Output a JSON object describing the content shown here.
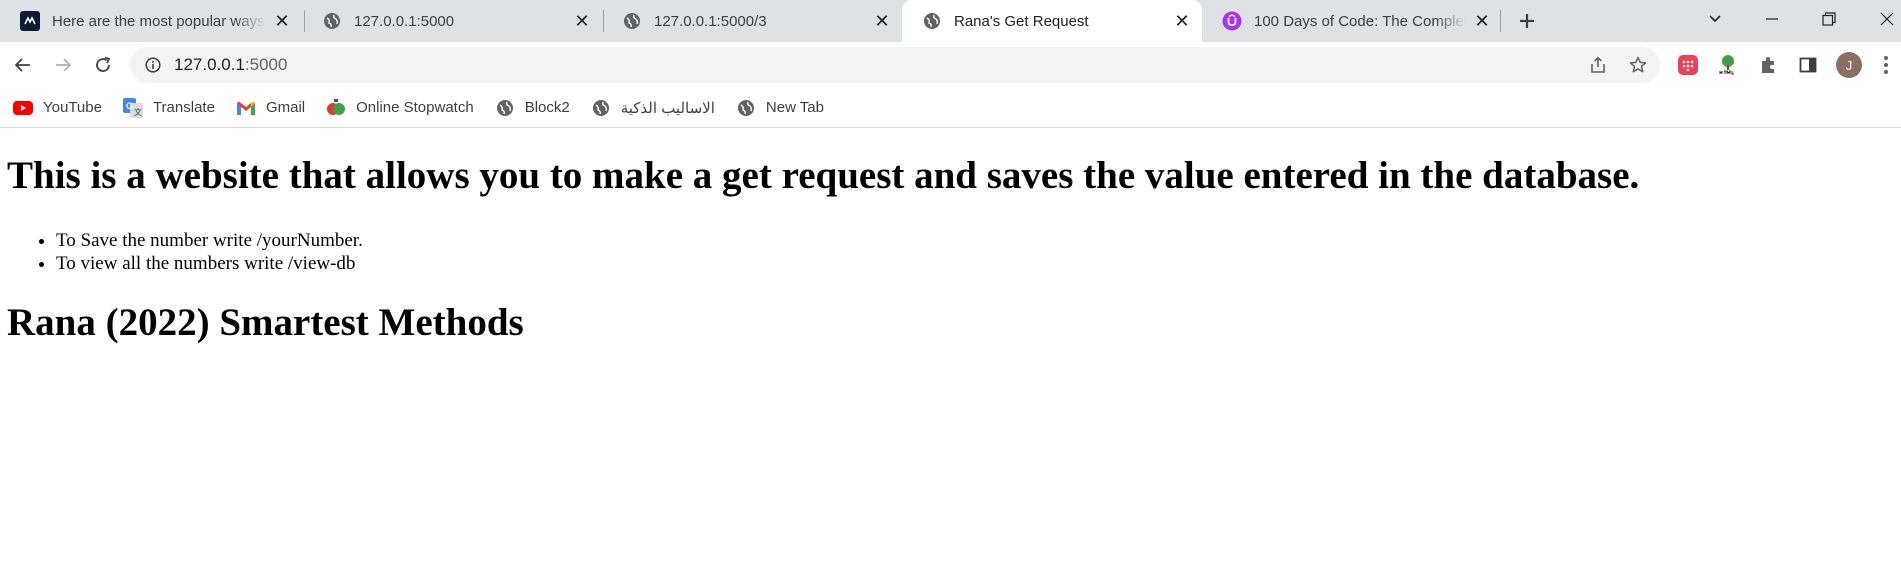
{
  "tabs": [
    {
      "title": "Here are the most popular ways t",
      "icon": "alpine-logo-icon",
      "active": false
    },
    {
      "title": "127.0.0.1:5000",
      "icon": "globe-icon",
      "active": false
    },
    {
      "title": "127.0.0.1:5000/3",
      "icon": "globe-icon",
      "active": false
    },
    {
      "title": "Rana's Get Request",
      "icon": "globe-icon",
      "active": true
    },
    {
      "title": "100 Days of Code: The Complete",
      "icon": "udemy-icon",
      "active": false
    }
  ],
  "address_bar": {
    "host": "127.0.0.1",
    "port": ":5000"
  },
  "bookmarks": [
    {
      "label": "YouTube",
      "icon": "youtube-icon"
    },
    {
      "label": "Translate",
      "icon": "translate-icon"
    },
    {
      "label": "Gmail",
      "icon": "gmail-icon"
    },
    {
      "label": "Online Stopwatch",
      "icon": "stopwatch-icon"
    },
    {
      "label": "Block2",
      "icon": "globe-icon"
    },
    {
      "label": "الاساليب الذكية",
      "icon": "globe-icon"
    },
    {
      "label": "New Tab",
      "icon": "globe-icon"
    }
  ],
  "profile": {
    "initial": "J",
    "color": "#8d6e63"
  },
  "page": {
    "heading": "This is a website that allows you to make a get request and saves the value entered in the database.",
    "instructions": [
      "To Save the number write /yourNumber.",
      "To view all the numbers write /view-db"
    ],
    "subheading": "Rana (2022) Smartest Methods"
  },
  "colors": {
    "tabstrip": "#dee1e6",
    "omnibox": "#f1f3f4",
    "text": "#202124"
  }
}
